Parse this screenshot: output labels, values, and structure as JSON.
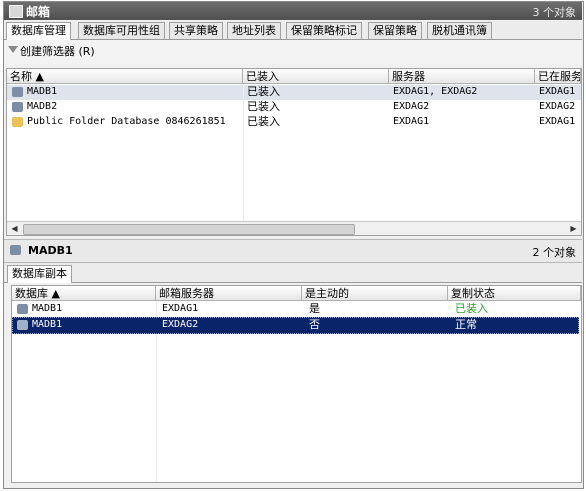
{
  "window": {
    "title": "邮箱",
    "object_count": "3 个对象"
  },
  "tabs": [
    {
      "label": "数据库管理"
    },
    {
      "label": "数据库可用性组"
    },
    {
      "label": "共享策略"
    },
    {
      "label": "地址列表"
    },
    {
      "label": "保留策略标记"
    },
    {
      "label": "保留策略"
    },
    {
      "label": "脱机通讯簿"
    }
  ],
  "toolbar": {
    "create_filter_label": "创建筛选器 (R)"
  },
  "db_list": {
    "columns": [
      "名称 ▲",
      "已装入",
      "服务器",
      "已在服务"
    ],
    "rows": [
      {
        "name": "MADB1",
        "mounted": "已装入",
        "servers": "EXDAG1, EXDAG2",
        "active_on": "EXDAG1"
      },
      {
        "name": "MADB2",
        "mounted": "已装入",
        "servers": "EXDAG2",
        "active_on": "EXDAG2"
      },
      {
        "name": "Public Folder Database 0846261851",
        "mounted": "已装入",
        "servers": "EXDAG1",
        "active_on": "EXDAG1"
      }
    ]
  },
  "detail": {
    "title": "MADB1",
    "object_count": "2 个对象"
  },
  "copy_tabs": [
    {
      "label": "数据库副本"
    }
  ],
  "copy_list": {
    "columns": [
      "数据库 ▲",
      "邮箱服务器",
      "是主动的",
      "复制状态"
    ],
    "rows": [
      {
        "database": "MADB1",
        "server": "EXDAG1",
        "active": "是",
        "status": "已装入"
      },
      {
        "database": "MADB1",
        "server": "EXDAG2",
        "active": "否",
        "status": "正常"
      }
    ]
  },
  "colors": {
    "selected_row": "#0a246a",
    "highlight_row": "#dfe4ec",
    "status_mounted": "#2e9e2e"
  }
}
